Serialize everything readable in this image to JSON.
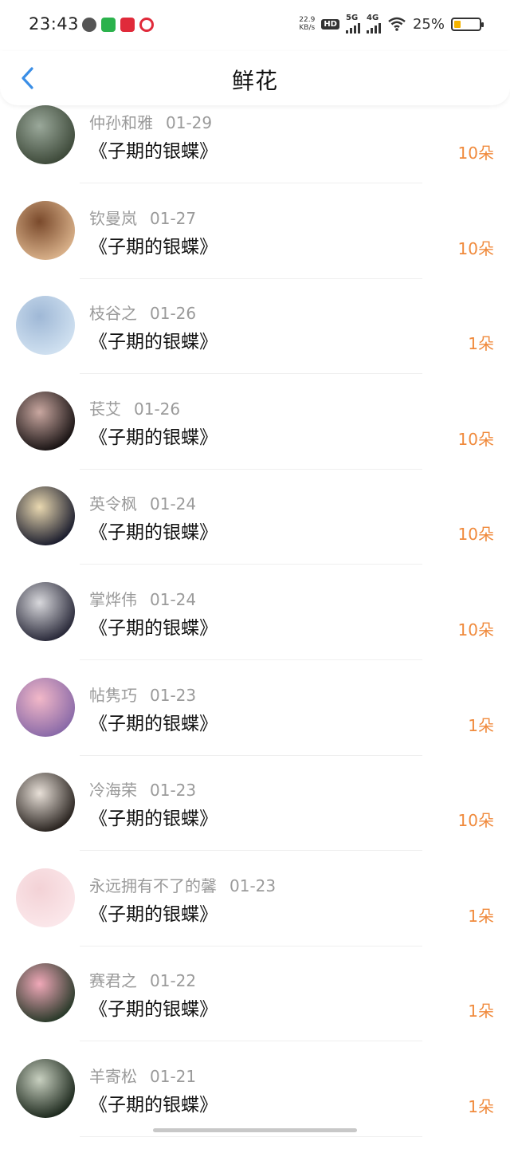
{
  "status_bar": {
    "time": "23:43",
    "net_speed_value": "22.9",
    "net_speed_unit": "KB/s",
    "hd_label": "HD",
    "sim1_label": "5G",
    "sim2_label": "4G",
    "battery_percent": "25%",
    "battery_level": 0.25
  },
  "header": {
    "title": "鲜花"
  },
  "colors": {
    "count": "#f08a3c",
    "meta": "#9a9a9a",
    "back": "#3a8ee6"
  },
  "items": [
    {
      "name": "仲孙和雅",
      "date": "01-29",
      "book": "《子期的银蝶》",
      "count": "10朵",
      "avatar_colors": [
        "#3e4a3a",
        "#9aa89a"
      ]
    },
    {
      "name": "钦曼岚",
      "date": "01-27",
      "book": "《子期的银蝶》",
      "count": "10朵",
      "avatar_colors": [
        "#d8b089",
        "#7a4a2c"
      ]
    },
    {
      "name": "枝谷之",
      "date": "01-26",
      "book": "《子期的银蝶》",
      "count": "1朵",
      "avatar_colors": [
        "#cfe0f0",
        "#9fb8d6"
      ]
    },
    {
      "name": "苌艾",
      "date": "01-26",
      "book": "《子期的银蝶》",
      "count": "10朵",
      "avatar_colors": [
        "#1a1414",
        "#c9a7a0"
      ]
    },
    {
      "name": "英令枫",
      "date": "01-24",
      "book": "《子期的银蝶》",
      "count": "10朵",
      "avatar_colors": [
        "#1c1e2e",
        "#e9d8b0"
      ]
    },
    {
      "name": "掌烨伟",
      "date": "01-24",
      "book": "《子期的银蝶》",
      "count": "10朵",
      "avatar_colors": [
        "#2a2a3a",
        "#d8d8dc"
      ]
    },
    {
      "name": "帖隽巧",
      "date": "01-23",
      "book": "《子期的银蝶》",
      "count": "1朵",
      "avatar_colors": [
        "#8a6aa8",
        "#f2b8c8"
      ]
    },
    {
      "name": "冷海荣",
      "date": "01-23",
      "book": "《子期的银蝶》",
      "count": "10朵",
      "avatar_colors": [
        "#2a2420",
        "#e8e0d8"
      ]
    },
    {
      "name": "永远拥有不了的馨",
      "date": "01-23",
      "book": "《子期的银蝶》",
      "count": "1朵",
      "avatar_colors": [
        "#fbe7ea",
        "#f3d2d6"
      ]
    },
    {
      "name": "赛君之",
      "date": "01-22",
      "book": "《子期的银蝶》",
      "count": "1朵",
      "avatar_colors": [
        "#2a3a2a",
        "#f0a8b8"
      ]
    },
    {
      "name": "羊寄松",
      "date": "01-21",
      "book": "《子期的银蝶》",
      "count": "1朵",
      "avatar_colors": [
        "#1e2a1e",
        "#c8d0c0"
      ]
    }
  ]
}
